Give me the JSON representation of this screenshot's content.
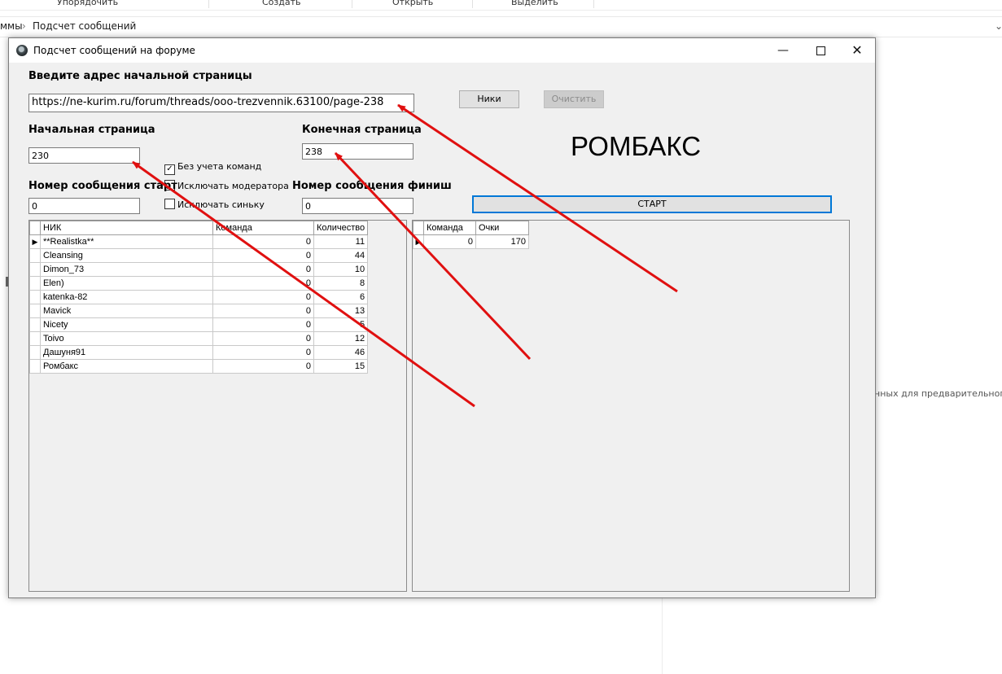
{
  "explorer": {
    "ribbon": [
      "Упорядочить",
      "Создать",
      "Открыть",
      "Выделить"
    ],
    "breadcrumb_prefix": "ммы",
    "breadcrumb_current": "Подсчет сообщений",
    "preview_hint": "нных для предварительного п"
  },
  "window": {
    "title": "Подсчет сообщений на форуме",
    "minimize": "—",
    "close": "✕"
  },
  "form": {
    "url_label": "Введите адрес начальной страницы",
    "url_value": "https://ne-kurim.ru/forum/threads/ooo-trezvennik.63100/page-238",
    "nicks_button": "Ники",
    "clear_button": "Очистить",
    "start_page_label": "Начальная страница",
    "start_page_value": "230",
    "end_page_label": "Конечная страница",
    "end_page_value": "238",
    "big_name": "РОМБАКС",
    "no_teams_label": "Без учета команд",
    "no_teams_checked": true,
    "exclude_moderator_label": "Исключать модератора",
    "exclude_moderator_checked": false,
    "exclude_blue_label": "Исключать синьку",
    "exclude_blue_checked": false,
    "msg_start_label": "Номер сообщения старт",
    "msg_start_value": "0",
    "msg_finish_label": "Номер сообщения финиш",
    "msg_finish_value": "0",
    "start_button": "СТАРТ"
  },
  "left_grid": {
    "columns": [
      "НИК",
      "Команда",
      "Количество"
    ],
    "rows": [
      [
        "**Realistka**",
        "0",
        "11"
      ],
      [
        "Cleansing",
        "0",
        "44"
      ],
      [
        "Dimon_73",
        "0",
        "10"
      ],
      [
        "Elen)",
        "0",
        "8"
      ],
      [
        "katenka-82",
        "0",
        "6"
      ],
      [
        "Mavick",
        "0",
        "13"
      ],
      [
        "Nicety",
        "0",
        "5"
      ],
      [
        "Toivo",
        "0",
        "12"
      ],
      [
        "Дашуня91",
        "0",
        "46"
      ],
      [
        "Ромбакс",
        "0",
        "15"
      ]
    ]
  },
  "right_grid": {
    "columns": [
      "Команда",
      "Очки"
    ],
    "rows": [
      [
        "0",
        "170"
      ]
    ]
  },
  "annotation_color": "#e01010"
}
